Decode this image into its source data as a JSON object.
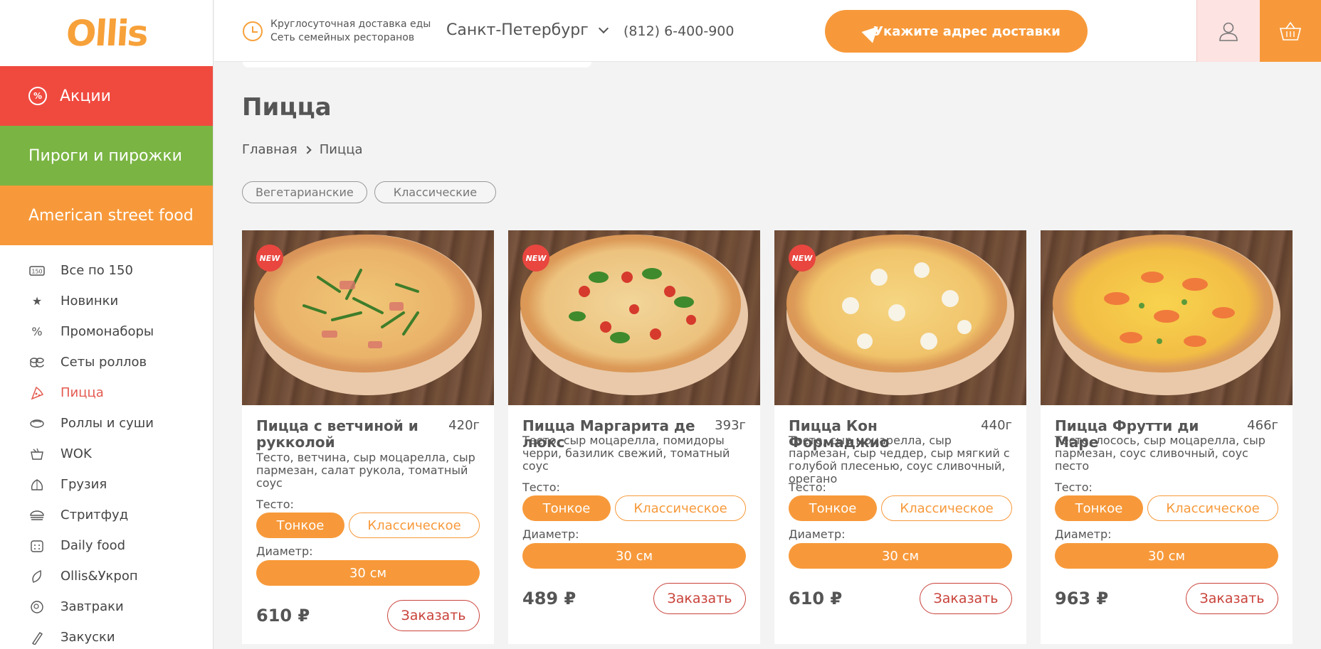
{
  "logo": "Ollis",
  "colors": {
    "accent": "#f7993a",
    "red": "#f04a3f",
    "green": "#7ab443",
    "order": "#c9423a"
  },
  "header": {
    "tagline1": "Круглосуточная доставка еды",
    "tagline2": "Сеть семейных ресторанов",
    "city": "Санкт-Петербург",
    "phone": "(812) 6-400-900",
    "address_button": "Укажите адрес доставки"
  },
  "sidebar": {
    "promos": [
      {
        "label": "Акции",
        "icon": "percent-badge-icon"
      },
      {
        "label": "Пироги и пирожки"
      },
      {
        "label": "American street food"
      }
    ],
    "items": [
      {
        "label": "Все по 150",
        "icon": "price-150-icon"
      },
      {
        "label": "Новинки",
        "icon": "star-icon"
      },
      {
        "label": "Промонаборы",
        "icon": "percent-icon"
      },
      {
        "label": "Сеты роллов",
        "icon": "rolls-set-icon"
      },
      {
        "label": "Пицца",
        "icon": "pizza-icon"
      },
      {
        "label": "Роллы и суши",
        "icon": "sushi-icon"
      },
      {
        "label": "WOK",
        "icon": "wok-icon"
      },
      {
        "label": "Грузия",
        "icon": "khinkali-icon"
      },
      {
        "label": "Стритфуд",
        "icon": "burger-icon"
      },
      {
        "label": "Daily food",
        "icon": "calendar-icon"
      },
      {
        "label": "Ollis&Укроп",
        "icon": "leaf-icon"
      },
      {
        "label": "Завтраки",
        "icon": "plate-icon"
      },
      {
        "label": "Закуски",
        "icon": "snack-icon"
      }
    ]
  },
  "page": {
    "title": "Пицца",
    "breadcrumb": [
      "Главная",
      "Пицца"
    ],
    "filters": [
      "Вегетарианские",
      "Классические"
    ]
  },
  "card_labels": {
    "dough": "Тесто:",
    "thin": "Тонкое",
    "classic": "Классическое",
    "diameter": "Диаметр:",
    "order": "Заказать",
    "new_badge": "NEW"
  },
  "products": [
    {
      "name": "Пицца с ветчиной и рукколой",
      "weight": "420г",
      "desc": "Тесто, ветчина, сыр моцарелла, сыр пармезан, салат рукола, томатный соус",
      "size": "30 см",
      "price": "610 ₽",
      "is_new": true
    },
    {
      "name": "Пицца Маргарита де люкс",
      "weight": "393г",
      "desc": "Тесто, сыр моцарелла, помидоры черри, базилик свежий, томатный соус",
      "size": "30 см",
      "price": "489 ₽",
      "is_new": true
    },
    {
      "name": "Пицца Кон Формаджио",
      "weight": "440г",
      "desc": "Тесто, сыр моцарелла, сыр пармезан, сыр чеддер, сыр мягкий с голубой плесенью, соус сливочный, орегано",
      "size": "30 см",
      "price": "610 ₽",
      "is_new": true
    },
    {
      "name": "Пицца Фрутти ди Маре",
      "weight": "466г",
      "desc": "Тесто, лосось, сыр моцарелла, сыр пармезан, соус сливочный, соус песто",
      "size": "30 см",
      "price": "963 ₽",
      "is_new": false
    }
  ]
}
